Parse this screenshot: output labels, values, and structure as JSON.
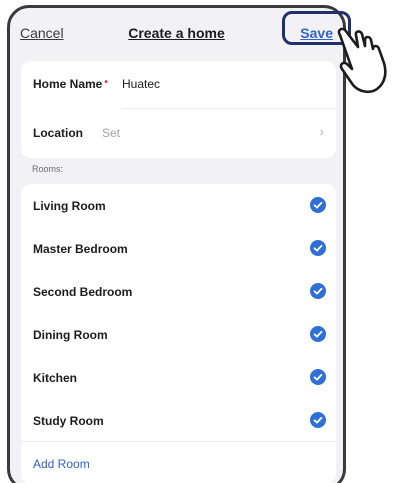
{
  "navbar": {
    "cancel_label": "Cancel",
    "title": "Create a home",
    "save_label": "Save"
  },
  "home_form": {
    "name_label": "Home Name",
    "required_marker": "•",
    "name_value": "Huatec",
    "location_label": "Location",
    "location_placeholder": "Set",
    "location_chevron": "›"
  },
  "rooms": {
    "section_label": "Rooms:",
    "items": [
      {
        "label": "Living Room",
        "checked": true
      },
      {
        "label": "Master Bedroom",
        "checked": true
      },
      {
        "label": "Second Bedroom",
        "checked": true
      },
      {
        "label": "Dining Room",
        "checked": true
      },
      {
        "label": "Kitchen",
        "checked": true
      },
      {
        "label": "Study Room",
        "checked": true
      }
    ],
    "add_room_label": "Add Room"
  },
  "colors": {
    "accent": "#2f63cc",
    "check": "#2f6fd6",
    "highlight_border": "#23306f",
    "background": "#f2f2f4"
  },
  "icons": {
    "pointer": "hand-pointer-icon",
    "check": "checkmark-circle-icon",
    "chevron": "chevron-right-icon"
  }
}
